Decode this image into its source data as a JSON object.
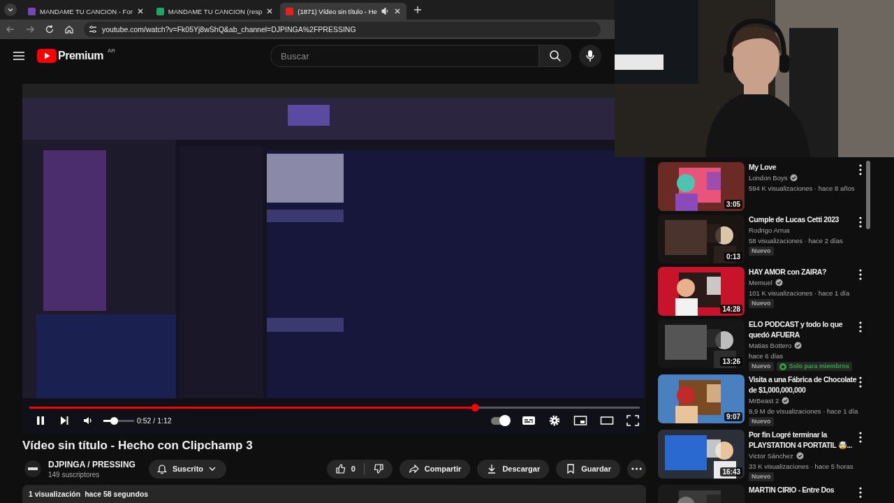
{
  "browser": {
    "tabs": [
      {
        "title": "MANDAME TU CANCION - For",
        "color": "#7248b9",
        "selected": false,
        "audio": false
      },
      {
        "title": "MANDAME TU CANCION (resp",
        "color": "#1fa463",
        "selected": false,
        "audio": false
      },
      {
        "title": "(1871) Vídeo sin título - He",
        "color": "#e62117",
        "selected": true,
        "audio": true
      }
    ],
    "address": "youtube.com/watch?v=Fk05Yj8wShQ&ab_channel=DJPINGA%2FPRESSING"
  },
  "header": {
    "logo": "Premium",
    "region": "AR",
    "search": {
      "placeholder": "Buscar"
    }
  },
  "player": {
    "progress": {
      "level": 0.73
    },
    "volume": {
      "level": 0.35
    },
    "time": "0:52 / 1:12",
    "playing": true,
    "autoplay": true
  },
  "video": {
    "title": "Vídeo sin título - Hecho con Clipchamp 3",
    "channel": {
      "name": "DJPINGA / PRESSING",
      "subscribers": "149 suscriptores"
    },
    "subscribe": {
      "label": "Suscrito",
      "subscribed": true
    },
    "likes": "0",
    "actions": [
      {
        "kind": "share",
        "label": "Compartir"
      },
      {
        "kind": "download",
        "label": "Descargar"
      },
      {
        "kind": "save",
        "label": "Guardar"
      }
    ],
    "views": "1 visualización",
    "date": "hace 58 segundos"
  },
  "recommendations": [
    {
      "title": "My Love",
      "channel": "London Boys",
      "verified": true,
      "meta": "594 K visualizaciones · hace 8 años",
      "duration": "3:05"
    },
    {
      "title": "Cumple de Lucas Cetti 2023",
      "channel": "Rodrigo Arrua",
      "verified": false,
      "meta": "58 visualizaciones · hace 2 días",
      "duration": "0:13",
      "badges": [
        {
          "kind": "new",
          "label": "Nuevo"
        }
      ]
    },
    {
      "title": "HAY AMOR con ZAIRA?",
      "channel": "Memuel",
      "verified": true,
      "meta": "101 K visualizaciones · hace 1 día",
      "duration": "14:28",
      "badges": [
        {
          "kind": "new",
          "label": "Nuevo"
        }
      ]
    },
    {
      "title": "ELO PODCAST y todo lo que quedó AFUERA",
      "channel": "Matias Bottero",
      "verified": true,
      "meta": "hace 6 días",
      "duration": "13:26",
      "badges": [
        {
          "kind": "new",
          "label": "Nuevo"
        },
        {
          "kind": "members",
          "label": "Solo para miembros"
        }
      ]
    },
    {
      "title": "Visita a una Fábrica de Chocolate de $1,000,000,000",
      "channel": "MrBeast 2",
      "verified": true,
      "meta": "9,9 M de visualizaciones · hace 1 día",
      "duration": "9:07",
      "badges": [
        {
          "kind": "new",
          "label": "Nuevo"
        }
      ]
    },
    {
      "title": "Por fin Logré terminar la PLAYSTATION 4 PORTATIL 🤯...",
      "channel": "Victor Sánchez",
      "verified": true,
      "meta": "33 K visualizaciones · hace 5 horas",
      "duration": "16:43",
      "badges": [
        {
          "kind": "new",
          "label": "Nuevo"
        }
      ]
    },
    {
      "title": "MARTIN CIRIO - Entre Dos"
    }
  ]
}
